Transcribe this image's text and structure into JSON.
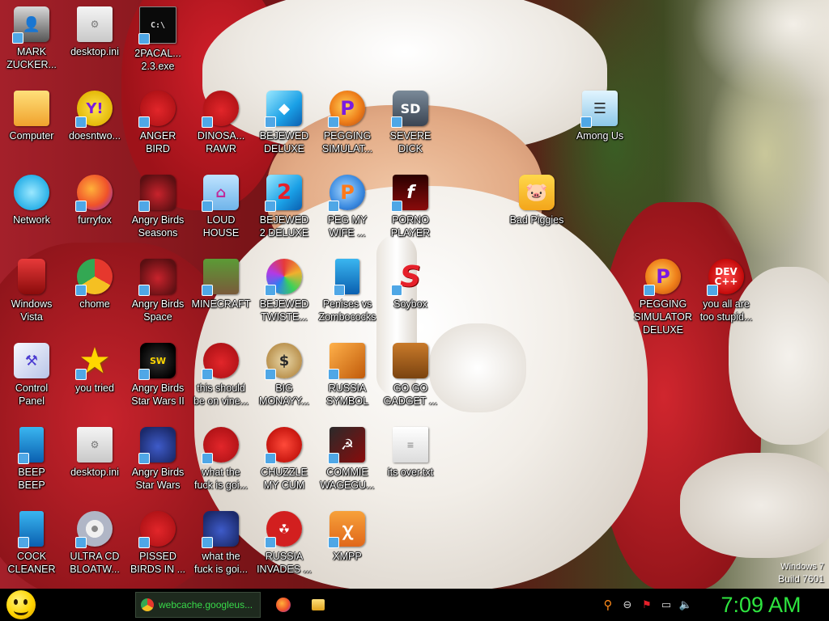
{
  "desktop": {
    "icons": [
      {
        "label": "MARK\nZUCKER...",
        "glyph": "👤",
        "icon": "person-icon"
      },
      {
        "label": "desktop.ini",
        "glyph": "⚙",
        "icon": "settings-file-icon"
      },
      {
        "label": "2PACAL...\n2.3.exe",
        "glyph": "C:\\",
        "icon": "console-icon"
      },
      {
        "label": "Computer",
        "glyph": "🖥",
        "icon": "computer-icon"
      },
      {
        "label": "doesntwo...",
        "glyph": "Y!",
        "icon": "yahoo-messenger-icon"
      },
      {
        "label": "ANGER\nBIRD",
        "glyph": "●",
        "icon": "angry-bird-icon"
      },
      {
        "label": "DINOSA...\nRAWR",
        "glyph": "●",
        "icon": "angry-bird-icon"
      },
      {
        "label": "BEJEWED\nDELUXE",
        "glyph": "◆",
        "icon": "gem-icon"
      },
      {
        "label": "PEGGING\nSIMULAT...",
        "glyph": "P",
        "icon": "peggle-icon"
      },
      {
        "label": "SEVERE\nDICK",
        "glyph": "SD",
        "icon": "sd-gear-icon"
      },
      {
        "label": "Among Us",
        "glyph": "☰",
        "icon": "among-us-icon"
      },
      {
        "label": "Network",
        "glyph": "🌐",
        "icon": "network-icon"
      },
      {
        "label": "furryfox",
        "glyph": "",
        "icon": "firefox-icon"
      },
      {
        "label": "Angry Birds\nSeasons",
        "glyph": "●",
        "icon": "angry-birds-seasons-icon"
      },
      {
        "label": "LOUD\nHOUSE",
        "glyph": "⌂",
        "icon": "house-icon"
      },
      {
        "label": "BEJEWED\n2 DELUXE",
        "glyph": "2",
        "icon": "gem-icon"
      },
      {
        "label": "PEG MY\nWIFE ...",
        "glyph": "P",
        "icon": "peggle-icon"
      },
      {
        "label": "PORNO\nPLAYER",
        "glyph": "f",
        "icon": "flash-player-icon"
      },
      {
        "label": "Bad Piggies",
        "glyph": "🐷",
        "icon": "bad-piggies-icon"
      },
      {
        "label": "Windows\nVista",
        "glyph": "",
        "icon": "recycle-bin-icon"
      },
      {
        "label": "chome",
        "glyph": "",
        "icon": "chrome-icon"
      },
      {
        "label": "Angry Birds\nSpace",
        "glyph": "●",
        "icon": "angry-birds-space-icon"
      },
      {
        "label": "MINECRAFT",
        "glyph": "■",
        "icon": "minecraft-icon"
      },
      {
        "label": "BEJEWED\nTWISTE...",
        "glyph": "",
        "icon": "gem-twist-icon"
      },
      {
        "label": "Penises vs\nZombococks",
        "glyph": "",
        "icon": "blue-folder-icon"
      },
      {
        "label": "Soybox",
        "glyph": "S",
        "icon": "soybox-icon"
      },
      {
        "label": "PEGGING\nSIMULATOR\nDELUXE",
        "glyph": "P",
        "icon": "peggle-icon"
      },
      {
        "label": "you all are\ntoo stupid...",
        "glyph": "DEV\nC++",
        "icon": "dev-cpp-icon"
      },
      {
        "label": "Control\nPanel",
        "glyph": "⚒",
        "icon": "control-panel-icon"
      },
      {
        "label": "you tried",
        "glyph": "★",
        "icon": "star-icon"
      },
      {
        "label": "Angry Birds\nStar Wars II",
        "glyph": "SW",
        "icon": "angry-birds-star-wars-icon"
      },
      {
        "label": "this should\nbe on vine...",
        "glyph": "●",
        "icon": "angry-bird-icon"
      },
      {
        "label": "BIG\nMONAYY...",
        "glyph": "$",
        "icon": "money-bag-icon"
      },
      {
        "label": "RUSSIA\nSYMBOL",
        "glyph": "",
        "icon": "russia-block-icon"
      },
      {
        "label": "GO GO\nGADGET ...",
        "glyph": "",
        "icon": "briefcase-icon"
      },
      {
        "label": "BEEP\nBEEP",
        "glyph": "",
        "icon": "blue-folder-icon"
      },
      {
        "label": "desktop.ini",
        "glyph": "⚙",
        "icon": "settings-file-icon"
      },
      {
        "label": "Angry Birds\nStar Wars",
        "glyph": "●",
        "icon": "angry-birds-star-wars-icon"
      },
      {
        "label": "what the\nfuck is goi...",
        "glyph": "●",
        "icon": "angry-bird-icon"
      },
      {
        "label": "CHUZZLE\nMY CUM",
        "glyph": "●",
        "icon": "chuzzle-icon"
      },
      {
        "label": "COMMIE\nWAGEGU...",
        "glyph": "☭",
        "icon": "commie-icon"
      },
      {
        "label": "its over.txt",
        "glyph": "≡",
        "icon": "text-file-icon"
      },
      {
        "label": "COCK\nCLEANER",
        "glyph": "",
        "icon": "blue-folder-icon"
      },
      {
        "label": "ULTRA CD\nBLOATW...",
        "glyph": "",
        "icon": "cd-icon"
      },
      {
        "label": "PISSED\nBIRDS IN ...",
        "glyph": "●",
        "icon": "angry-bird-icon"
      },
      {
        "label": "what the\nfuck is goi...",
        "glyph": "●",
        "icon": "angry-birds-space-icon"
      },
      {
        "label": "RUSSIA\nINVADES ...",
        "glyph": "☢",
        "icon": "radiation-icon"
      },
      {
        "label": "XMPP",
        "glyph": "ꭓ",
        "icon": "xampp-icon"
      }
    ]
  },
  "watermark": {
    "line1": "Windows 7",
    "line2": "Build 7601"
  },
  "taskbar": {
    "chrome_task_label": "webcache.googleus...",
    "clock": "7:09 AM",
    "tray": {
      "search": "⚲",
      "minus": "⊖",
      "flag": "⚑",
      "network": "▭",
      "volume": "🔈"
    }
  }
}
